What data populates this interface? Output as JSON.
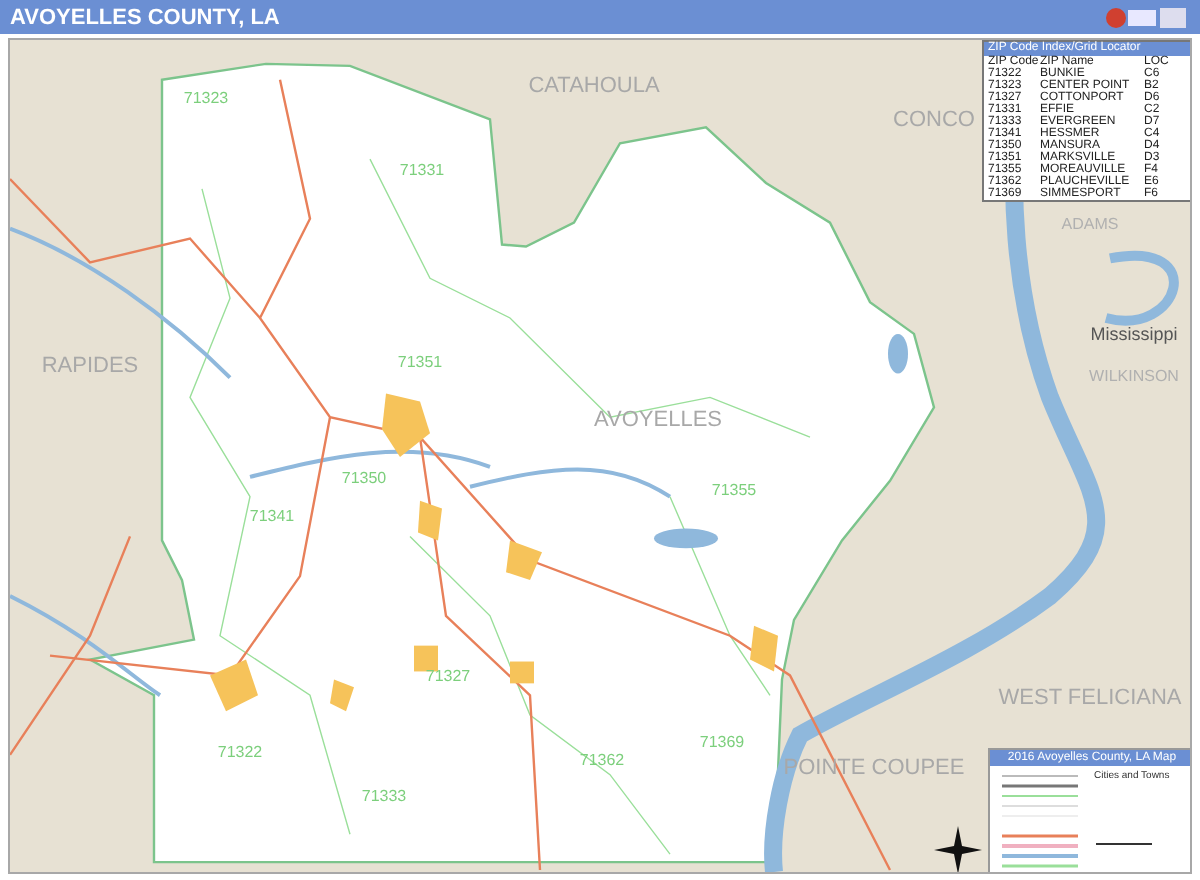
{
  "header": {
    "title": "AVOYELLES COUNTY, LA"
  },
  "map": {
    "regions": [
      {
        "name": "CATAHOULA",
        "kind": "county"
      },
      {
        "name": "CONCO",
        "kind": "county"
      },
      {
        "name": "ADAMS",
        "kind": "neighbor"
      },
      {
        "name": "Mississippi",
        "kind": "state"
      },
      {
        "name": "WILKINSON",
        "kind": "neighbor"
      },
      {
        "name": "RAPIDES",
        "kind": "county"
      },
      {
        "name": "AVOYELLES",
        "kind": "county"
      },
      {
        "name": "WEST FELICIANA",
        "kind": "county"
      },
      {
        "name": "POINTE COUPEE",
        "kind": "county"
      }
    ],
    "zip_labels": [
      "71323",
      "71331",
      "71351",
      "71350",
      "71341",
      "71355",
      "71327",
      "71322",
      "71362",
      "71369",
      "71333"
    ]
  },
  "zip_index": {
    "title": "ZIP Code Index/Grid Locator",
    "columns": [
      "ZIP Code",
      "ZIP Name",
      "LOC"
    ],
    "rows": [
      [
        "71322",
        "BUNKIE",
        "C6"
      ],
      [
        "71323",
        "CENTER POINT",
        "B2"
      ],
      [
        "71327",
        "COTTONPORT",
        "D6"
      ],
      [
        "71331",
        "EFFIE",
        "C2"
      ],
      [
        "71333",
        "EVERGREEN",
        "D7"
      ],
      [
        "71341",
        "HESSMER",
        "C4"
      ],
      [
        "71350",
        "MANSURA",
        "D4"
      ],
      [
        "71351",
        "MARKSVILLE",
        "D3"
      ],
      [
        "71355",
        "MOREAUVILLE",
        "F4"
      ],
      [
        "71362",
        "PLAUCHEVILLE",
        "E6"
      ],
      [
        "71369",
        "SIMMESPORT",
        "F6"
      ]
    ]
  },
  "legend": {
    "title": "2016 Avoyelles County, LA Map",
    "section": "Cities and Towns"
  }
}
